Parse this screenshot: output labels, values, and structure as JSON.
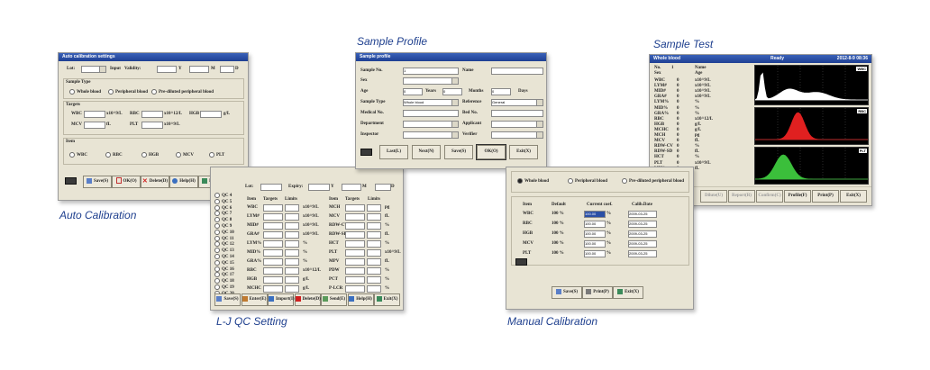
{
  "captions": {
    "auto_calibration": "Auto Calibration",
    "lj_qc_setting": "L-J QC Setting",
    "sample_profile": "Sample Profile",
    "manual_calibration": "Manual Calibration",
    "sample_test": "Sample Test"
  },
  "auto_cal": {
    "title": "Auto calibration settings",
    "lot_label": "Lot:",
    "input_label": "Input",
    "validity_label": "Validity:",
    "y": "Y",
    "m": "M",
    "d": "D",
    "sample_type_label": "Sample Type",
    "sample_types": [
      "Whole blood",
      "Peripheral blood",
      "Pre-diluted peripheral blood"
    ],
    "targets_label": "Targets",
    "targets": [
      {
        "name": "WBC",
        "unit": "x10^9/L"
      },
      {
        "name": "RBC",
        "unit": "x10^12/L"
      },
      {
        "name": "HGB",
        "unit": "g/L"
      },
      {
        "name": "MCV",
        "unit": "fL"
      },
      {
        "name": "PLT",
        "unit": "x10^9/L"
      }
    ],
    "items_label": "Item",
    "items": [
      "WBC",
      "RBC",
      "HGB",
      "MCV",
      "PLT"
    ],
    "buttons": [
      "Save(S)",
      "OK(O)",
      "Delete(D)",
      "Help(H)",
      "Exit(X)"
    ]
  },
  "lj_qc": {
    "lot_label": "Lot:",
    "expiry_label": "Expiry:",
    "y": "Y",
    "m": "M",
    "d": "D",
    "qc_list": [
      "QC 4",
      "QC 5",
      "QC 6",
      "QC 7",
      "QC 8",
      "QC 9",
      "QC 10",
      "QC 11",
      "QC 12",
      "QC 13",
      "QC 14",
      "QC 15",
      "QC 16",
      "QC 17",
      "QC 18",
      "QC 19",
      "QC 20"
    ],
    "headers": [
      "Item",
      "Targets",
      "Limits"
    ],
    "left_rows": [
      {
        "item": "WBC",
        "unit": "x10^9/L"
      },
      {
        "item": "LYM#",
        "unit": "x10^9/L"
      },
      {
        "item": "MID#",
        "unit": "x10^9/L"
      },
      {
        "item": "GRA#",
        "unit": "x10^9/L"
      },
      {
        "item": "LYM%",
        "unit": "%"
      },
      {
        "item": "MID%",
        "unit": "%"
      },
      {
        "item": "GRA%",
        "unit": "%"
      },
      {
        "item": "RBC",
        "unit": "x10^12/L"
      },
      {
        "item": "HGB",
        "unit": "g/L"
      },
      {
        "item": "MCHC",
        "unit": "g/L"
      }
    ],
    "right_rows": [
      {
        "item": "MCH",
        "unit": "pg"
      },
      {
        "item": "MCV",
        "unit": "fL"
      },
      {
        "item": "RDW-CV",
        "unit": "%"
      },
      {
        "item": "RDW-SD",
        "unit": "fL"
      },
      {
        "item": "HCT",
        "unit": "%"
      },
      {
        "item": "PLT",
        "unit": "x10^9/L"
      },
      {
        "item": "MPV",
        "unit": "fL"
      },
      {
        "item": "PDW",
        "unit": "%"
      },
      {
        "item": "PCT",
        "unit": "%"
      },
      {
        "item": "P-LCR",
        "unit": "%"
      }
    ],
    "buttons": [
      "Save(S)",
      "Enter(E)",
      "Import(I)",
      "Delete(D)",
      "Send(E)",
      "Help(H)",
      "Exit(X)"
    ]
  },
  "sample_profile": {
    "title": "Sample profile",
    "fields": {
      "sample_no": "Sample No.",
      "sample_no_value": "1",
      "name": "Name",
      "sex": "Sex",
      "age": "Age",
      "age_years_value": "0",
      "years": "Years",
      "age_months_value": "0",
      "months": "Months",
      "age_days_value": "0",
      "days": "Days",
      "sample_type": "Sample Type",
      "sample_type_value": "Whole blood",
      "reference": "Reference",
      "reference_value": "General",
      "medical_no": "Medical No.",
      "bed_no": "Bed No.",
      "department": "Department",
      "applicant": "Applicant",
      "inspector": "Inspector",
      "verifier": "Verifier"
    },
    "buttons": [
      "Last(L)",
      "Next(N)",
      "Save(S)",
      "OK(O)",
      "Exit(X)"
    ]
  },
  "manual_cal": {
    "sample_types": [
      "Whole blood",
      "Peripheral blood",
      "Pre-diluted peripheral blood"
    ],
    "headers": [
      "Item",
      "Default",
      "Current coef.",
      "Calib.Date"
    ],
    "rows": [
      {
        "item": "WBC",
        "default": "100 %",
        "coef": "100.00",
        "unit": "%",
        "date": "2009-03-25"
      },
      {
        "item": "RBC",
        "default": "100 %",
        "coef": "100.00",
        "unit": "%",
        "date": "2009-03-25"
      },
      {
        "item": "HGB",
        "default": "100 %",
        "coef": "100.00",
        "unit": "%",
        "date": "2009-03-25"
      },
      {
        "item": "MCV",
        "default": "100 %",
        "coef": "100.00",
        "unit": "%",
        "date": "2009-03-25"
      },
      {
        "item": "PLT",
        "default": "100 %",
        "coef": "100.00",
        "unit": "%",
        "date": "2009-03-25"
      }
    ],
    "buttons": [
      "Save(S)",
      "Print(P)",
      "Exit(X)"
    ]
  },
  "sample_test": {
    "title_left": "Whole blood",
    "status": "Ready",
    "datetime": "2012-8-9 08:36",
    "no_label": "No.",
    "no_value": "1",
    "name_label": "Name",
    "sex_label": "Sex",
    "age_label": "Age",
    "params": [
      {
        "name": "WBC",
        "value": "0",
        "unit": "x10^9/L"
      },
      {
        "name": "LYM#",
        "value": "0",
        "unit": "x10^9/L"
      },
      {
        "name": "MID#",
        "value": "0",
        "unit": "x10^9/L"
      },
      {
        "name": "GRA#",
        "value": "0",
        "unit": "x10^9/L"
      },
      {
        "name": "LYM%",
        "value": "0",
        "unit": "%"
      },
      {
        "name": "MID%",
        "value": "0",
        "unit": "%"
      },
      {
        "name": "GRA%",
        "value": "0",
        "unit": "%"
      },
      {
        "name": "RBC",
        "value": "0",
        "unit": "x10^12/L"
      },
      {
        "name": "HGB",
        "value": "0",
        "unit": "g/L"
      },
      {
        "name": "MCHC",
        "value": "0",
        "unit": "g/L"
      },
      {
        "name": "MCH",
        "value": "0",
        "unit": "pg"
      },
      {
        "name": "MCV",
        "value": "0",
        "unit": "fL"
      },
      {
        "name": "RDW-CV",
        "value": "0",
        "unit": "%"
      },
      {
        "name": "RDW-SD",
        "value": "0",
        "unit": "fL"
      },
      {
        "name": "HCT",
        "value": "0",
        "unit": "%"
      },
      {
        "name": "PLT",
        "value": "0",
        "unit": "x10^9/L"
      },
      {
        "name": "MPV",
        "value": "0",
        "unit": "fL"
      }
    ],
    "plots": [
      "WBC",
      "RBC",
      "PLT"
    ],
    "plot_colors": {
      "WBC": "#ffffff",
      "RBC": "#e02020",
      "PLT": "#3bbf3b"
    },
    "buttons": [
      "Dilute(U)",
      "Report(R)",
      "Confirm(C)",
      "Profile(F)",
      "Print(P)",
      "Exit(X)"
    ]
  },
  "colors": {
    "caption": "#1e3f8e",
    "titlebar": "#2a4fa6",
    "window_bg": "#e8e4d4"
  }
}
